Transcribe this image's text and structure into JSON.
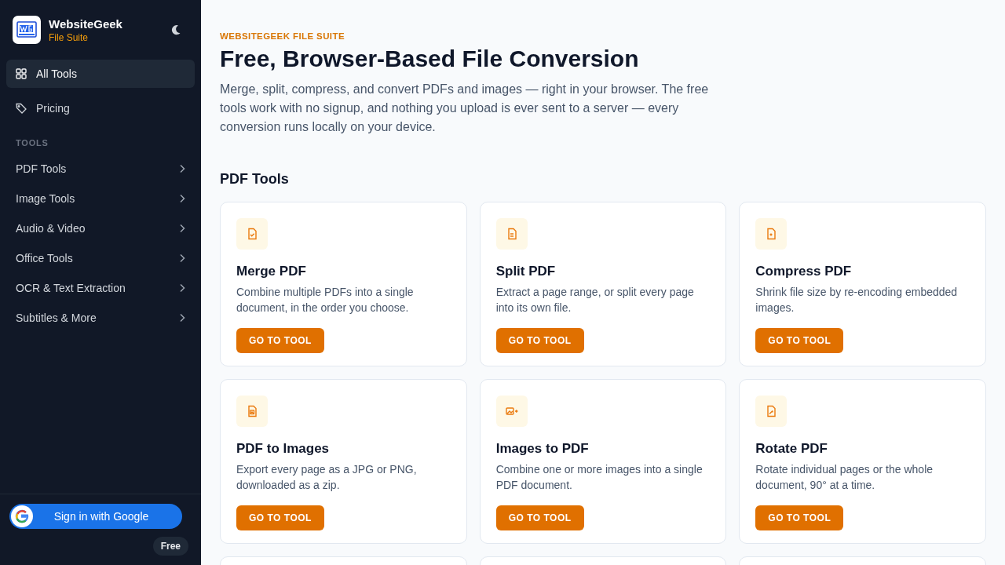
{
  "sidebar": {
    "brand": {
      "name": "WebsiteGeek",
      "subtitle": "File Suite"
    },
    "nav": [
      {
        "label": "All Tools",
        "selected": true
      },
      {
        "label": "Pricing",
        "selected": false
      }
    ],
    "section_label": "TOOLS",
    "groups": [
      {
        "label": "PDF Tools"
      },
      {
        "label": "Image Tools"
      },
      {
        "label": "Audio & Video"
      },
      {
        "label": "Office Tools"
      },
      {
        "label": "OCR & Text Extraction"
      },
      {
        "label": "Subtitles & More"
      }
    ],
    "sign_in": "Sign in with Google",
    "plan_badge": "Free"
  },
  "main": {
    "eyebrow": "WEBSITEGEEK FILE SUITE",
    "title": "Free, Browser-Based File Conversion",
    "intro": "Merge, split, compress, and convert PDFs and images — right in your browser. The free tools work with no signup, and nothing you upload is ever sent to a server — every conversion runs locally on your device.",
    "section_title": "PDF Tools",
    "cards": [
      {
        "kind": "tool",
        "title": "Merge PDF",
        "description": "Combine multiple PDFs into a single document, in the order you choose.",
        "button": "GO TO TOOL"
      },
      {
        "kind": "tool",
        "title": "Split PDF",
        "description": "Extract a page range, or split every page into its own file.",
        "button": "GO TO TOOL"
      },
      {
        "kind": "tool",
        "title": "Compress PDF",
        "description": "Shrink file size by re-encoding embedded images.",
        "button": "GO TO TOOL"
      },
      {
        "kind": "tool",
        "title": "PDF to Images",
        "description": "Export every page as a JPG or PNG, downloaded as a zip.",
        "button": "GO TO TOOL"
      },
      {
        "kind": "tool",
        "title": "Images to PDF",
        "description": "Combine one or more images into a single PDF document.",
        "button": "GO TO TOOL"
      },
      {
        "kind": "tool",
        "title": "Rotate PDF",
        "description": "Rotate individual pages or the whole document, 90° at a time.",
        "button": "GO TO TOOL"
      },
      {
        "kind": "cut"
      },
      {
        "kind": "cut"
      },
      {
        "kind": "cut"
      }
    ]
  }
}
